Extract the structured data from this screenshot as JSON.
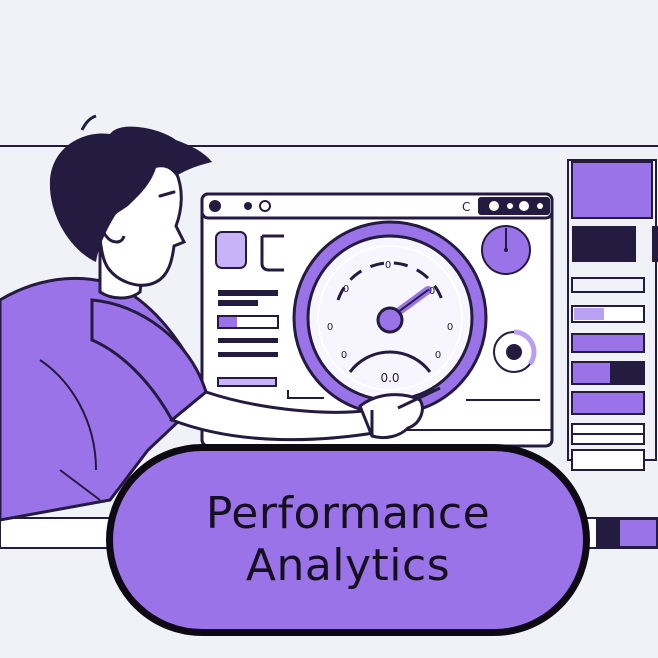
{
  "banner": {
    "line1": "Performance",
    "line2": "Analytics"
  },
  "gauge": {
    "label": "0.0",
    "ticks": [
      "0",
      "0",
      "0",
      "0",
      "0",
      "0",
      "0"
    ]
  },
  "colors": {
    "accent": "#9b73e8",
    "ink": "#241b40",
    "background": "#f1f2f8"
  }
}
